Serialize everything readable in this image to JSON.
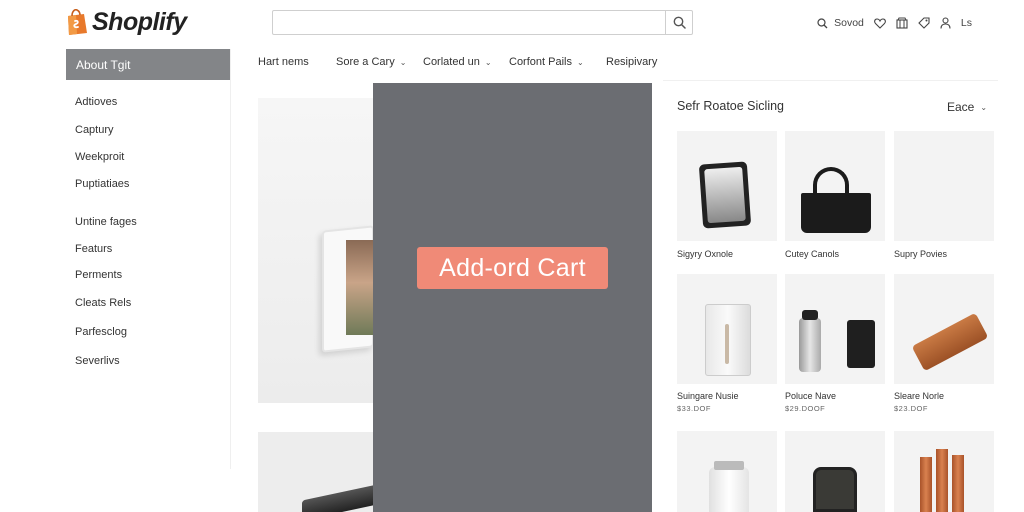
{
  "brand": {
    "name": "Shoplify"
  },
  "search": {
    "value": "",
    "placeholder": ""
  },
  "header": {
    "saved_label": "Sovod",
    "account_label": "Ls"
  },
  "sidebar": {
    "active": "About Tgit",
    "items": [
      "Adtioves",
      "Captury",
      "Weekproit",
      "Puptiatiaes",
      "Untine fages",
      "Featurs",
      "Perments",
      "Cleats Rels",
      "Parfesclog",
      "Severlivs"
    ]
  },
  "topnav": {
    "items": [
      {
        "label": "Hart nems",
        "dropdown": false
      },
      {
        "label": "Sore a Cary",
        "dropdown": true
      },
      {
        "label": "Corlated un",
        "dropdown": true
      },
      {
        "label": "Corfont Pails",
        "dropdown": true
      },
      {
        "label": "Resipivary",
        "dropdown": false
      }
    ]
  },
  "overlay": {
    "button_label": "Add-ord Cart"
  },
  "results": {
    "title": "Sefr Roatoe Sicling",
    "sort_label": "Eace",
    "products": [
      {
        "name": "Sigyry Oxnole",
        "price": ""
      },
      {
        "name": "Cutey Canols",
        "price": ""
      },
      {
        "name": "Supry Povies",
        "price": ""
      },
      {
        "name": "Suingare Nusie",
        "price": "$33.DOF"
      },
      {
        "name": "Poluce Nave",
        "price": "$29.DOOF"
      },
      {
        "name": "Sleare Norle",
        "price": "$23.DOF"
      }
    ]
  },
  "colors": {
    "overlay": "#6b6d72",
    "cart_button": "#f08a77",
    "sidebar_active": "#838588",
    "brand_green": "#95bf47"
  }
}
